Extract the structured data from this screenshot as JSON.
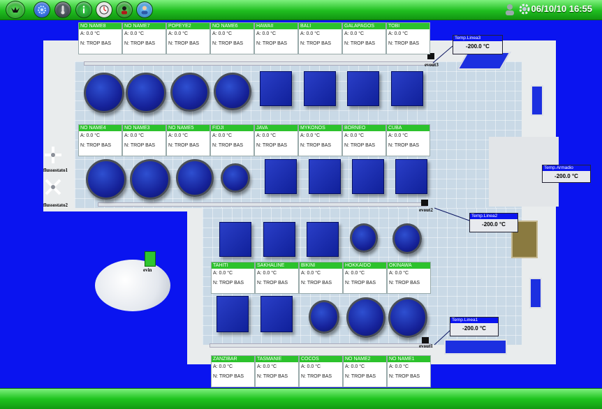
{
  "header": {
    "datetime": "06/10/10 16:55",
    "buttons": [
      {
        "icon": "bird-logo-icon"
      },
      {
        "icon": "gear-icon"
      },
      {
        "icon": "thermometer-icon"
      },
      {
        "icon": "info-icon"
      },
      {
        "icon": "clock-icon"
      },
      {
        "icon": "technician-icon"
      },
      {
        "icon": "user-icon"
      }
    ]
  },
  "units": {
    "row1": [
      {
        "name": "NO NAME8",
        "a": "A: 0.0 °C",
        "n": "N: TROP BAS"
      },
      {
        "name": "NO NAME7",
        "a": "A: 0.0 °C",
        "n": "N: TROP BAS"
      },
      {
        "name": "POPEYE2",
        "a": "A: 0.0 °C",
        "n": "N: TROP BAS"
      },
      {
        "name": "NO NAME6",
        "a": "A: 0.0 °C",
        "n": "N: TROP BAS"
      },
      {
        "name": "HAWAII",
        "a": "A: 0.0 °C",
        "n": "N: TROP BAS"
      },
      {
        "name": "BALI",
        "a": "A: 0.0 °C",
        "n": "N: TROP BAS"
      },
      {
        "name": "GALAPAGOS",
        "a": "A: 0.0 °C",
        "n": "N: TROP BAS"
      },
      {
        "name": "TOBI",
        "a": "A: 0.0 °C",
        "n": "N: TROP BAS"
      }
    ],
    "row2": [
      {
        "name": "NO NAME4",
        "a": "A: 0.0 °C",
        "n": "N: TROP BAS"
      },
      {
        "name": "NO NAME3",
        "a": "A: 0.0 °C",
        "n": "N: TROP BAS"
      },
      {
        "name": "NO NAME5",
        "a": "A: 0.0 °C",
        "n": "N: TROP BAS"
      },
      {
        "name": "FIDJI",
        "a": "A: 0.0 °C",
        "n": "N: TROP BAS"
      },
      {
        "name": "JAVA",
        "a": "A: 0.0 °C",
        "n": "N: TROP BAS"
      },
      {
        "name": "MYKONOS",
        "a": "A: 0.0 °C",
        "n": "N: TROP BAS"
      },
      {
        "name": "BORNEO",
        "a": "A: 0.0 °C",
        "n": "N: TROP BAS"
      },
      {
        "name": "CUBA",
        "a": "A: 0.0 °C",
        "n": "N: TROP BAS"
      }
    ],
    "row3": [
      {
        "name": "TAHITI",
        "a": "A: 0.0 °C",
        "n": "N: TROP BAS"
      },
      {
        "name": "SAKHALINE",
        "a": "A: 0.0 °C",
        "n": "N: TROP BAS"
      },
      {
        "name": "BIKINI",
        "a": "A: 0.0 °C",
        "n": "N: TROP BAS"
      },
      {
        "name": "HOKKAIDO",
        "a": "A: 0.0 °C",
        "n": "N: TROP BAS"
      },
      {
        "name": "OKINAWA",
        "a": "A: 0.0 °C",
        "n": "N: TROP BAS"
      }
    ],
    "row4": [
      {
        "name": "ZANZIBAR",
        "a": "A: 0.0 °C",
        "n": "N: TROP BAS"
      },
      {
        "name": "TASMANIE",
        "a": "A: 0.0 °C",
        "n": "N: TROP BAS"
      },
      {
        "name": "COCOS",
        "a": "A: 0.0 °C",
        "n": "N: TROP BAS"
      },
      {
        "name": "NO NAME2",
        "a": "A: 0.0 °C",
        "n": "N: TROP BAS"
      },
      {
        "name": "NO NAME1",
        "a": "A: 0.0 °C",
        "n": "N: TROP BAS"
      }
    ]
  },
  "sensors": {
    "linea3": {
      "title": "Temp.Linea3",
      "value": "-200.0 °C"
    },
    "armadio": {
      "title": "Temp.Armadio",
      "value": "-200.0 °C"
    },
    "linea2": {
      "title": "Temp.Linea2",
      "value": "-200.0 °C"
    },
    "linea1": {
      "title": "Temp.Linea1",
      "value": "-200.0 °C"
    }
  },
  "labels": {
    "evout3": "evout3",
    "evout2": "evout2",
    "evout1": "evout1",
    "evin": "evin",
    "flux1": "flussostato1",
    "flux2": "flussostato2"
  },
  "colors": {
    "background": "#0a14f0",
    "bar_green": "#1fbe1f",
    "header_green": "#2cc22c",
    "tank_blue": "#16229a"
  }
}
